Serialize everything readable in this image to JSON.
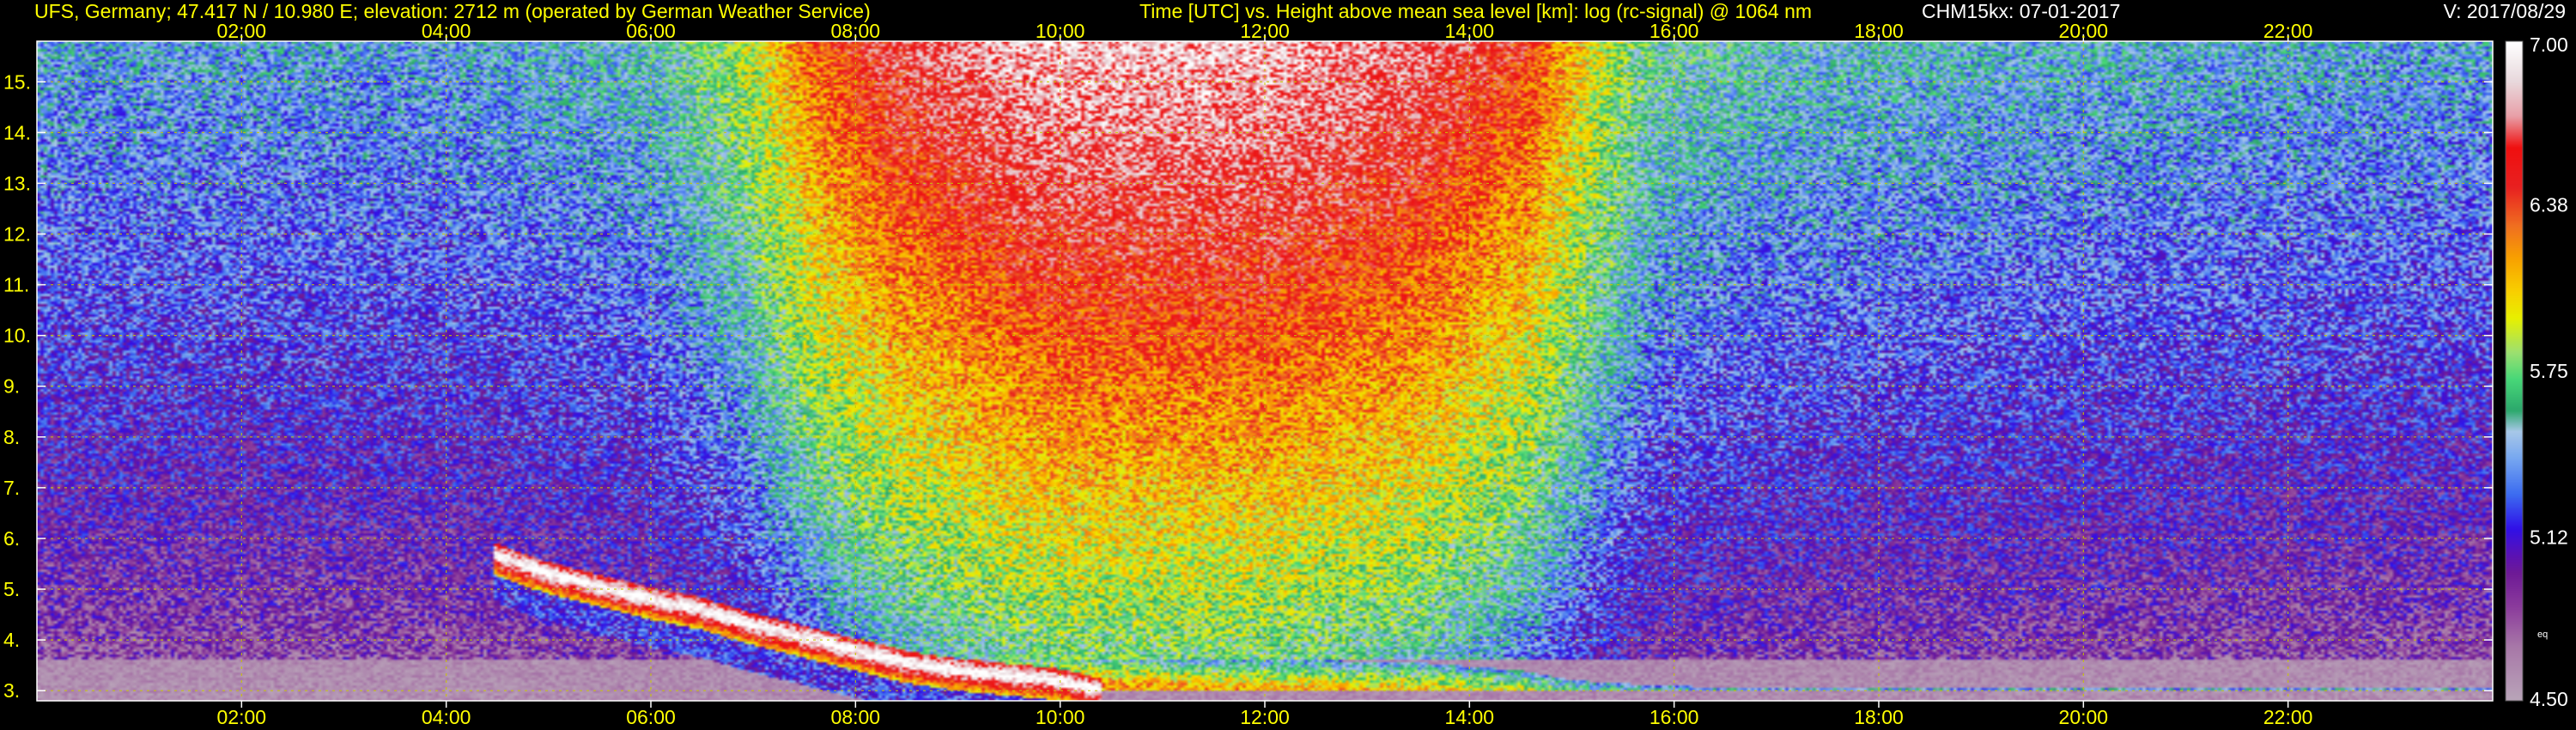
{
  "header": {
    "station": "UFS, Germany; 47.417 N / 10.980 E; elevation: 2712 m  (operated by German Weather Service)",
    "title": "Time [UTC] vs. Height above mean sea level [km]: log (rc-signal) @ 1064 nm",
    "instrument": "CHM15kx: 07-01-2017",
    "version": "V: 2017/08/29"
  },
  "chart_data": {
    "type": "heatmap",
    "title": "Time [UTC] vs. Height above mean sea level [km]: log (rc-signal) @ 1064 nm",
    "xlabel": "Time [UTC]",
    "ylabel": "Height above mean sea level [km]",
    "x_unit": "hours UTC",
    "xlim": [
      0,
      24
    ],
    "x_ticks": [
      2,
      4,
      6,
      8,
      10,
      12,
      14,
      16,
      18,
      20,
      22
    ],
    "x_tick_labels": [
      "02:00",
      "04:00",
      "06:00",
      "08:00",
      "10:00",
      "12:00",
      "14:00",
      "16:00",
      "18:00",
      "20:00",
      "22:00"
    ],
    "ylim": [
      2.8,
      15.8
    ],
    "y_ticks": [
      3,
      4,
      5,
      6,
      7,
      8,
      9,
      10,
      11,
      12,
      13,
      14,
      15
    ],
    "y_tick_labels": [
      "3.",
      "4.",
      "5.",
      "6.",
      "7.",
      "8.",
      "9.",
      "10.",
      "11.",
      "12.",
      "13.",
      "14.",
      "15."
    ],
    "grid": true,
    "grid_color": "#c8c800",
    "colorbar": {
      "min": 4.5,
      "max": 7.0,
      "ticks": [
        4.5,
        5.12,
        5.75,
        6.38,
        7.0
      ],
      "tick_labels": [
        "4.50",
        "5.12",
        "5.75",
        "6.38",
        "7.00"
      ],
      "note": "eq",
      "stops": [
        {
          "value": 4.5,
          "color": "#b9a4b9"
        },
        {
          "value": 4.7,
          "color": "#a878a8"
        },
        {
          "value": 4.85,
          "color": "#8c3c9c"
        },
        {
          "value": 4.98,
          "color": "#6e1a96"
        },
        {
          "value": 5.05,
          "color": "#5a12b4"
        },
        {
          "value": 5.15,
          "color": "#3010e8"
        },
        {
          "value": 5.28,
          "color": "#3c6cf0"
        },
        {
          "value": 5.42,
          "color": "#78a8f0"
        },
        {
          "value": 5.52,
          "color": "#a8c8e8"
        },
        {
          "value": 5.6,
          "color": "#2ca86c"
        },
        {
          "value": 5.72,
          "color": "#48d878"
        },
        {
          "value": 5.82,
          "color": "#9ce070"
        },
        {
          "value": 5.95,
          "color": "#e8f000"
        },
        {
          "value": 6.05,
          "color": "#f8d000"
        },
        {
          "value": 6.18,
          "color": "#f8a000"
        },
        {
          "value": 6.3,
          "color": "#f07020"
        },
        {
          "value": 6.45,
          "color": "#e82020"
        },
        {
          "value": 6.6,
          "color": "#f01010"
        },
        {
          "value": 6.72,
          "color": "#e8a0a8"
        },
        {
          "value": 6.85,
          "color": "#e8d8dc"
        },
        {
          "value": 7.0,
          "color": "#ffffff"
        }
      ]
    },
    "background_signal": [
      {
        "time": 0,
        "low": 4.75,
        "high": 5.45
      },
      {
        "time": 4,
        "low": 4.75,
        "high": 5.45
      },
      {
        "time": 6,
        "low": 4.8,
        "high": 5.55
      },
      {
        "time": 6.9,
        "low": 4.9,
        "high": 5.85
      },
      {
        "time": 7.6,
        "low": 5.1,
        "high": 6.35
      },
      {
        "time": 8.3,
        "low": 5.3,
        "high": 6.6
      },
      {
        "time": 9.5,
        "low": 5.5,
        "high": 6.8
      },
      {
        "time": 10,
        "low": 5.55,
        "high": 6.85
      },
      {
        "time": 12,
        "low": 5.55,
        "high": 6.85
      },
      {
        "time": 13.5,
        "low": 5.45,
        "high": 6.7
      },
      {
        "time": 14.6,
        "low": 5.2,
        "high": 6.45
      },
      {
        "time": 15.2,
        "low": 5.0,
        "high": 6.0
      },
      {
        "time": 15.8,
        "low": 4.85,
        "high": 5.65
      },
      {
        "time": 17,
        "low": 4.8,
        "high": 5.55
      },
      {
        "time": 20,
        "low": 4.77,
        "high": 5.5
      },
      {
        "time": 24,
        "low": 4.75,
        "high": 5.45
      }
    ],
    "cloud_top_km": [
      {
        "time": 4.45,
        "height": 5.85
      },
      {
        "time": 5.0,
        "height": 5.45
      },
      {
        "time": 5.5,
        "height": 5.2
      },
      {
        "time": 6.0,
        "height": 4.95
      },
      {
        "time": 6.5,
        "height": 4.75
      },
      {
        "time": 7.0,
        "height": 4.45
      },
      {
        "time": 7.5,
        "height": 4.2
      },
      {
        "time": 8.0,
        "height": 3.95
      },
      {
        "time": 8.5,
        "height": 3.7
      },
      {
        "time": 9.0,
        "height": 3.55
      },
      {
        "time": 9.5,
        "height": 3.45
      },
      {
        "time": 10.0,
        "height": 3.35
      },
      {
        "time": 10.4,
        "height": 3.15
      }
    ],
    "boundary_layer_km": [
      {
        "time": 9.3,
        "height": 3.8
      },
      {
        "time": 10.5,
        "height": 3.75
      },
      {
        "time": 11.5,
        "height": 3.65
      },
      {
        "time": 12.5,
        "height": 3.6
      },
      {
        "time": 13.5,
        "height": 3.55
      },
      {
        "time": 14.5,
        "height": 3.4
      },
      {
        "time": 15.0,
        "height": 3.2
      },
      {
        "time": 16.0,
        "height": 3.08
      },
      {
        "time": 24.0,
        "height": 3.05
      }
    ]
  }
}
